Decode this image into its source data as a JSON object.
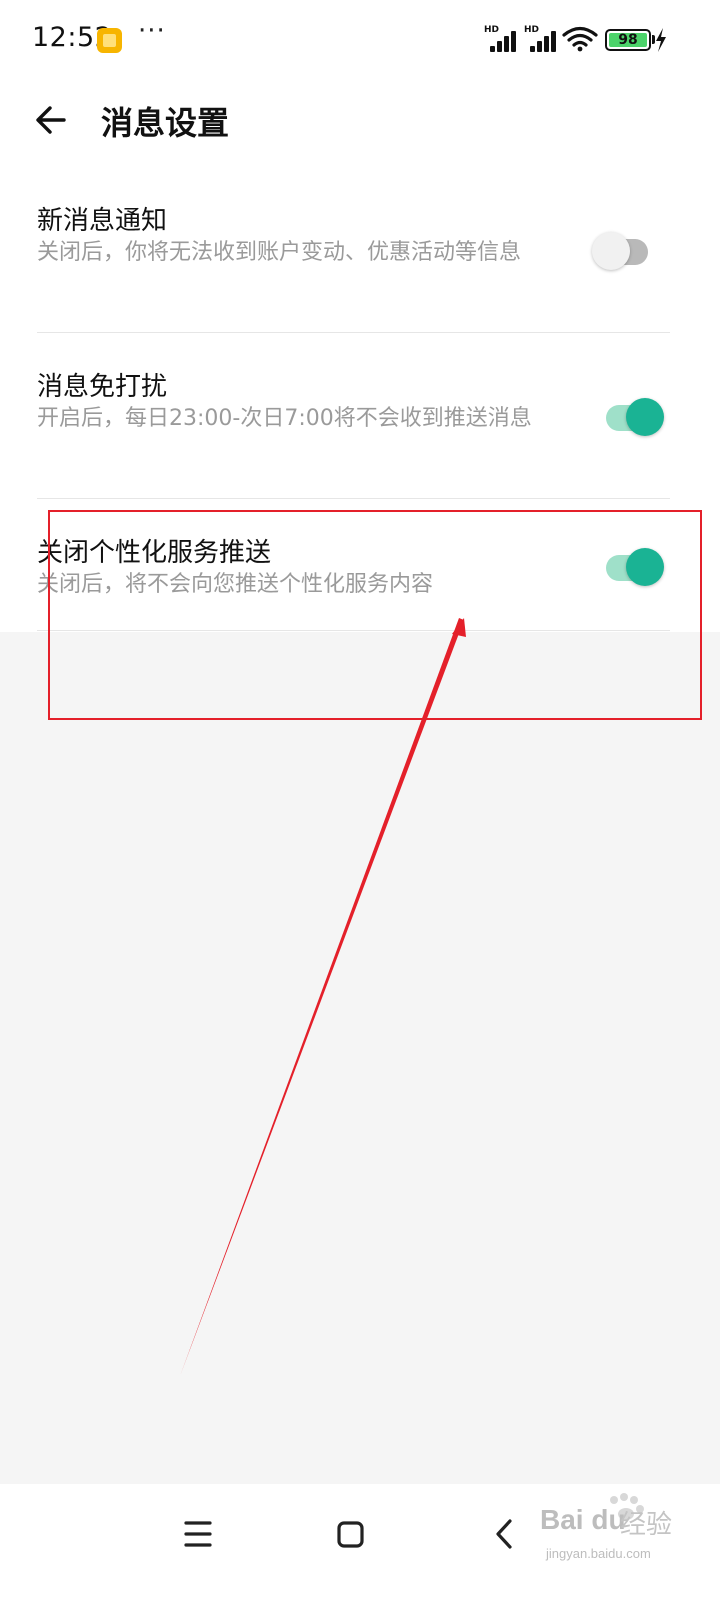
{
  "status_bar": {
    "time": "12:52",
    "more": "···",
    "signal_label": "HD",
    "battery_level": "98",
    "app_notification_icon": "note-app-icon"
  },
  "header": {
    "title": "消息设置",
    "back_icon": "arrow-left-icon"
  },
  "settings": [
    {
      "title": "新消息通知",
      "description": "关闭后，你将无法收到账户变动、优惠活动等信息",
      "enabled": false
    },
    {
      "title": "消息免打扰",
      "description": "开启后，每日23:00-次日7:00将不会收到推送消息",
      "enabled": true
    },
    {
      "title": "关闭个性化服务推送",
      "description": "关闭后，将不会向您推送个性化服务内容",
      "enabled": true
    }
  ],
  "colors": {
    "toggle_on": "#1ab394",
    "toggle_off": "#b9b9b9",
    "annotation": "#e4202a"
  },
  "nav_bar": {
    "menu_icon": "menu-icon",
    "home_icon": "home-icon",
    "back_icon": "back-chevron-icon"
  },
  "watermark": {
    "brand": "Bai du",
    "cn": "经验",
    "url": "jingyan.baidu.com"
  }
}
